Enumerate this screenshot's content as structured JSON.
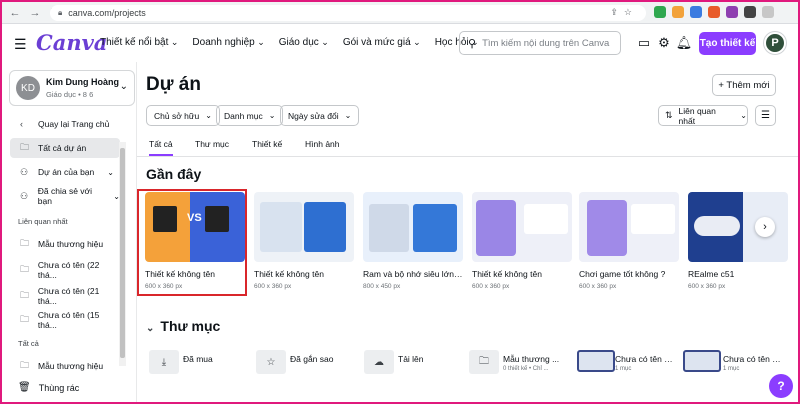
{
  "browser": {
    "url": "canva.com/projects"
  },
  "header": {
    "logo": "Canva",
    "nav": [
      "Thiết kế nổi bật",
      "Doanh nghiệp",
      "Giáo dục",
      "Gói và mức giá",
      "Học hỏi"
    ],
    "search_placeholder": "Tìm kiếm nội dung trên Canva",
    "create_label": "Tạo thiết kế",
    "avatar_letter": "P",
    "accent": "#8b3dff"
  },
  "sidebar": {
    "account_initials": "KD",
    "account_name": "Kim Dung Hoàng",
    "account_sub": "Giáo dục • 8 6",
    "back": "Quay lại Trang chủ",
    "items": [
      "Tất cả dự án",
      "Dự án của bạn",
      "Đã chia sẻ với bạn"
    ],
    "section1": "Liên quan nhất",
    "recent": [
      "Mẫu thương hiệu",
      "Chưa có tên (22 thá...",
      "Chưa có tên (21 thá...",
      "Chưa có tên (15 thá..."
    ],
    "section2": "Tất cả",
    "all_items": [
      "Mẫu thương hiệu"
    ],
    "trash": "Thùng rác"
  },
  "main": {
    "title": "Dự án",
    "add_new": "+ Thêm mới",
    "filters": [
      "Chủ sở hữu",
      "Danh mục",
      "Ngày sửa đổi"
    ],
    "sort": "Liên quan nhất",
    "tabs": [
      "Tất cả",
      "Thư mục",
      "Thiết kế",
      "Hình ảnh"
    ],
    "recent_heading": "Gần đây",
    "folders_heading": "Thư mục",
    "cards": [
      {
        "title": "Thiết kế không tên",
        "size": "600 x 360 px"
      },
      {
        "title": "Thiết kế không tên",
        "size": "600 x 360 px"
      },
      {
        "title": "Ram và bộ nhớ siêu lớn vẫ...",
        "size": "800 x 450 px"
      },
      {
        "title": "Thiết kế không tên",
        "size": "600 x 360 px"
      },
      {
        "title": "Chơi game tốt không ?",
        "size": "600 x 360 px"
      },
      {
        "title": "REalme c51",
        "size": "600 x 360 px"
      }
    ],
    "folders": [
      {
        "name": "Đã mua",
        "sub": ""
      },
      {
        "name": "Đã gắn sao",
        "sub": ""
      },
      {
        "name": "Tải lên",
        "sub": ""
      },
      {
        "name": "Mẫu thương ...",
        "sub": "0 thiết kế • Chỉ ..."
      },
      {
        "name": "Chưa có tên (...",
        "sub": "1 mục"
      },
      {
        "name": "Chưa có tên (...",
        "sub": "1 mục"
      }
    ]
  }
}
